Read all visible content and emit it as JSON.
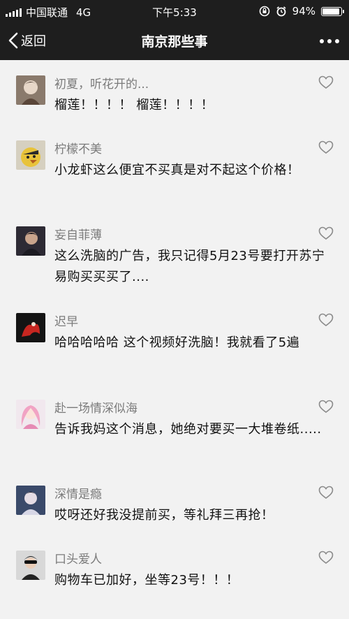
{
  "status_bar": {
    "carrier": "中国联通",
    "network": "4G",
    "time": "下午5:33",
    "battery_text": "94%",
    "battery_level": 0.94
  },
  "nav": {
    "back_label": "返回",
    "title": "南京那些事",
    "more_icon": "more-dots-icon"
  },
  "comments": [
    {
      "nickname": "初夏，听花开的...",
      "text": "榴莲！！！！ 榴莲！！！！"
    },
    {
      "nickname": "柠檬不美",
      "text": "小龙虾这么便宜不买真是对不起这个价格！"
    },
    {
      "nickname": "妄自菲薄",
      "text": "这么洗脑的广告，我只记得5月23号要打开苏宁易购买买买了...."
    },
    {
      "nickname": "迟早",
      "text": "哈哈哈哈哈 这个视频好洗脑！我就看了5遍"
    },
    {
      "nickname": "赴一场情深似海",
      "text": "告诉我妈这个消息，她绝对要买一大堆卷纸....."
    },
    {
      "nickname": "深情是瘾",
      "text": "哎呀还好我没提前买，等礼拜三再抢！"
    },
    {
      "nickname": "口头爱人",
      "text": "购物车已加好，坐等23号！！！"
    }
  ]
}
